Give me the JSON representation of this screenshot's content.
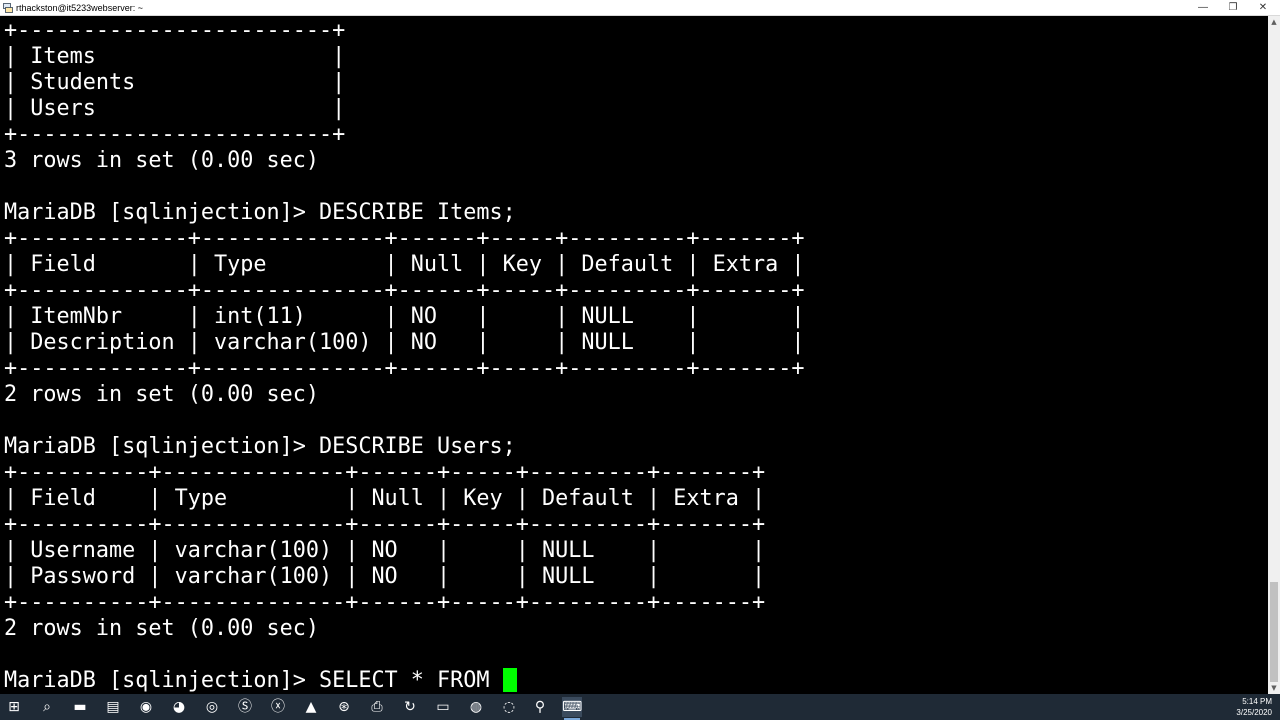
{
  "window": {
    "title": "rthackston@it5233webserver: ~",
    "minimize_glyph": "—",
    "restore_glyph": "❐",
    "close_glyph": "✕"
  },
  "terminal": {
    "lines": [
      "+------------------------+",
      "| Items                  |",
      "| Students               |",
      "| Users                  |",
      "+------------------------+",
      "3 rows in set (0.00 sec)",
      "",
      "MariaDB [sqlinjection]> DESCRIBE Items;",
      "+-------------+--------------+------+-----+---------+-------+",
      "| Field       | Type         | Null | Key | Default | Extra |",
      "+-------------+--------------+------+-----+---------+-------+",
      "| ItemNbr     | int(11)      | NO   |     | NULL    |       |",
      "| Description | varchar(100) | NO   |     | NULL    |       |",
      "+-------------+--------------+------+-----+---------+-------+",
      "2 rows in set (0.00 sec)",
      "",
      "MariaDB [sqlinjection]> DESCRIBE Users;",
      "+----------+--------------+------+-----+---------+-------+",
      "| Field    | Type         | Null | Key | Default | Extra |",
      "+----------+--------------+------+-----+---------+-------+",
      "| Username | varchar(100) | NO   |     | NULL    |       |",
      "| Password | varchar(100) | NO   |     | NULL    |       |",
      "+----------+--------------+------+-----+---------+-------+",
      "2 rows in set (0.00 sec)",
      ""
    ],
    "prompt_line": "MariaDB [sqlinjection]> SELECT * FROM ",
    "cursor_color": "#00ff00",
    "text_color": "#ffffff",
    "background_color": "#000000"
  },
  "taskbar": {
    "background_color": "#1f2a36",
    "icons": [
      {
        "name": "windows-start-icon",
        "glyph": "⊞"
      },
      {
        "name": "search-icon",
        "glyph": "⌕"
      },
      {
        "name": "file-explorer-icon",
        "glyph": "▬"
      },
      {
        "name": "notepad-icon",
        "glyph": "▤"
      },
      {
        "name": "chrome-icon",
        "glyph": "◉"
      },
      {
        "name": "firefox-icon",
        "glyph": "◕"
      },
      {
        "name": "discord-icon",
        "glyph": "◎"
      },
      {
        "name": "skype-icon",
        "glyph": "Ⓢ"
      },
      {
        "name": "xbox-icon",
        "glyph": "ⓧ"
      },
      {
        "name": "azure-icon",
        "glyph": "▲"
      },
      {
        "name": "steam-icon",
        "glyph": "⊛"
      },
      {
        "name": "printer-icon",
        "glyph": "⎙"
      },
      {
        "name": "refresh-app-icon",
        "glyph": "↻"
      },
      {
        "name": "remote-desktop-icon",
        "glyph": "▭"
      },
      {
        "name": "network-icon",
        "glyph": "◍"
      },
      {
        "name": "browser-icon",
        "glyph": "◌"
      },
      {
        "name": "maps-icon",
        "glyph": "⚲"
      },
      {
        "name": "putty-icon",
        "glyph": "⌨"
      }
    ],
    "clock_time": "5:14 PM",
    "clock_date": "3/25/2020"
  }
}
